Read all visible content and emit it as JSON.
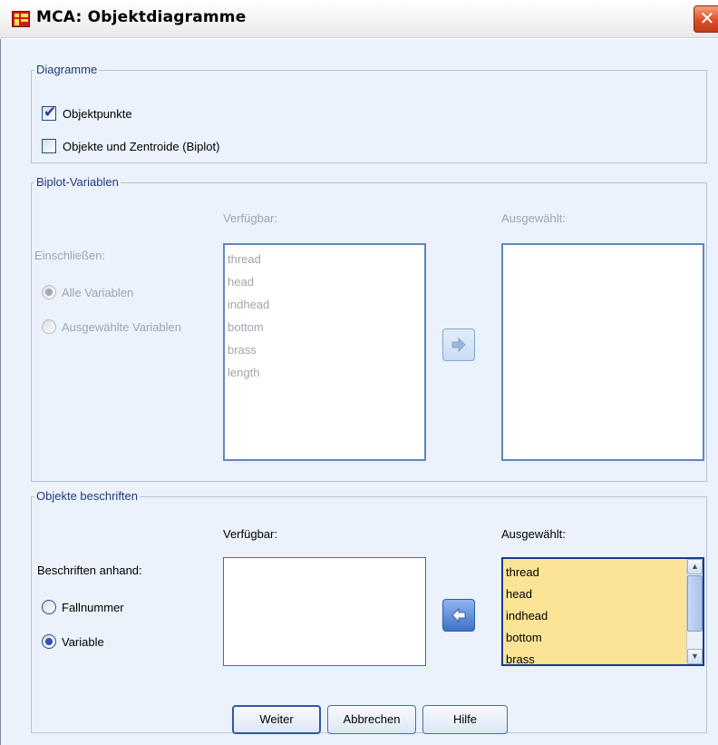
{
  "window": {
    "title": "MCA: Objektdiagramme",
    "close_glyph": "✕"
  },
  "diagramme": {
    "label": "Diagramme",
    "objektpunkte": {
      "label": "Objektpunkte",
      "checked": true
    },
    "biplot": {
      "label": "Objekte und Zentroide (Biplot)",
      "checked": false
    }
  },
  "biplot_variablen": {
    "label": "Biplot-Variablen",
    "enabled": false,
    "verfuegbar_label": "Verfügbar:",
    "ausgewaehlt_label": "Ausgewählt:",
    "einschliessen_label": "Einschließen:",
    "radio_alle": "Alle Variablen",
    "radio_ausgewaehlte": "Ausgewählte Variablen",
    "selected_radio": "alle",
    "available_items": [
      "thread",
      "head",
      "indhead",
      "bottom",
      "brass",
      "length"
    ],
    "selected_items": [],
    "move_icon": "arrow-right-icon"
  },
  "objekte_beschriften": {
    "label": "Objekte beschriften",
    "verfuegbar_label": "Verfügbar:",
    "ausgewaehlt_label": "Ausgewählt:",
    "beschriften_label": "Beschriften anhand:",
    "radio_fallnummer": "Fallnummer",
    "radio_variable": "Variable",
    "selected_radio": "variable",
    "available_items": [],
    "selected_items": [
      "thread",
      "head",
      "indhead",
      "bottom",
      "brass"
    ],
    "move_icon": "arrow-left-icon"
  },
  "buttons": {
    "weiter": "Weiter",
    "abbrechen": "Abbrechen",
    "hilfe": "Hilfe"
  },
  "colors": {
    "client_bg": "#ebf2fc",
    "group_label": "#213a79",
    "selected_list_bg": "#fbe496",
    "close_red": "#d9502a"
  }
}
